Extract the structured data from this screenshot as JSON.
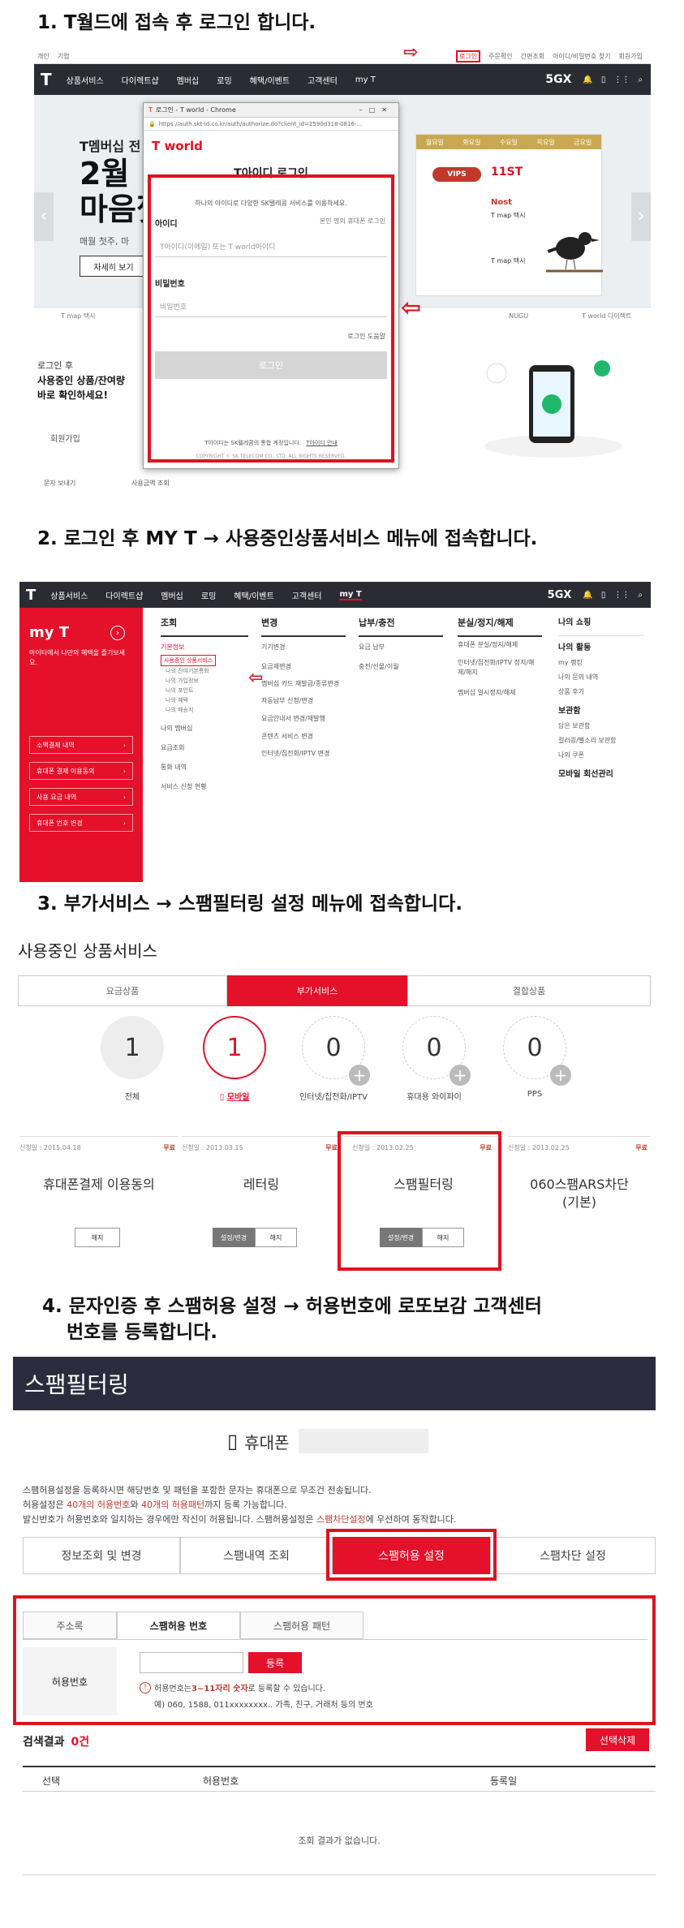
{
  "steps": {
    "s1": "1. T월드에 접속 후 로그인 합니다.",
    "s2": "2. 로그인 후 MY T → 사용중인상품서비스 메뉴에 접속합니다.",
    "s3": "3. 부가서비스 → 스팸필터링 설정 메뉴에 접속합니다.",
    "s4_line1": "4. 문자인증 후 스팸허용 설정  → 허용번호에 로또보감 고객센터",
    "s4_line2": "번호를 등록합니다."
  },
  "tworld": {
    "util_left": [
      "개인",
      "기업"
    ],
    "util_right": [
      "로그인",
      "주문확인",
      "간편조회",
      "아이디/비밀번호 찾기",
      "회원가입"
    ],
    "nav": [
      "상품서비스",
      "다이렉트샵",
      "멤버십",
      "로밍",
      "혜택/이벤트",
      "고객센터",
      "my T"
    ],
    "brand_5gx": "5GX",
    "hero_line1": "T멤버십 전",
    "hero_line2": "2월",
    "hero_line3": "마음껏",
    "hero_sub": "매월 첫주, 마",
    "hero_btn": "자세히 보기",
    "cal_days": [
      "월요일",
      "화요일",
      "수요일",
      "목요일",
      "금요일"
    ],
    "cal_items": [
      "VIPS",
      "11ST",
      "Nost",
      "T map 택시",
      "T map 택시"
    ],
    "tabs": [
      "T map 택시",
      "",
      "",
      "",
      "",
      "NUGU",
      "T world 다이렉트"
    ],
    "promo_line1": "로그인 후",
    "promo_line2": "사용중인 상품/잔여량",
    "promo_line3": "바로 확인하세요!",
    "bottom_items": [
      "회원가입",
      "문자 보내기",
      "사용금액 조회"
    ],
    "popup": {
      "window_title": "로그인 - T world - Chrome",
      "url": "https://auth.skt-id.co.kr/auth/authorize.do?client_id=2590d318-0816-...",
      "logo": "T world",
      "title": "T아이디 로그인",
      "desc": "하나의 아이디로 다양한 SK텔레콤 서비스를 이용하세요.",
      "id_label": "아이디",
      "id_hint": "본인 명의 휴대폰 로그인",
      "id_placeholder": "T아이디(이메일) 또는 T world아이디",
      "pw_label": "비밀번호",
      "pw_placeholder": "비밀번호",
      "help": "로그인 도움말",
      "login_btn": "로그인",
      "footer1": "T아이디는 SK텔레콤의 통합 계정입니다.",
      "footer_link": "T아이디 안내",
      "copyright": "COPYRIGHT © SK TELECOM CO., LTD. ALL RIGHTS RESERVED."
    }
  },
  "myt": {
    "nav": [
      "상품서비스",
      "다이렉트샵",
      "멤버십",
      "로밍",
      "혜택/이벤트",
      "고객센터",
      "my T"
    ],
    "brand_5gx": "5GX",
    "title": "my T",
    "desc": "마이티에서 나만의 혜택을 즐기보세요.",
    "side_buttons": [
      "소액결제 내역",
      "휴대폰 결제 이용동의",
      "사용 요금 내역",
      "휴대폰 번호 변경"
    ],
    "col1": {
      "head": "조회",
      "items": [
        "기본정보",
        "사용중인 상품서비스",
        "나의 잔여기본통화",
        "나의 가입정보",
        "나의 포인트",
        "나의 혜택",
        "나의 배송지",
        "나의 멤버십",
        "요금조회",
        "통화 내역",
        "서비스 신청 현황"
      ]
    },
    "col2": {
      "head": "변경",
      "items": [
        "기기변경",
        "요금제변경",
        "멤버십 카드 재발급/종류변경",
        "자동납부 신청/변경",
        "요금안내서 변경/재발행",
        "콘텐츠 서비스 변경",
        "인터넷/집전화/IPTV 변경"
      ]
    },
    "col3": {
      "head": "납부/충전",
      "items": [
        "요금 납부",
        "충전/선물/이월"
      ]
    },
    "col4": {
      "head": "분실/정지/해제",
      "items": [
        "휴대폰 분실/정지/해제",
        "인터넷/집전화/IPTV 정지/해제/해지",
        "멤버십 일시정지/해제"
      ]
    },
    "col5": {
      "items": [
        "나의 쇼핑",
        "나의 활동",
        "my 랭킹",
        "나의 문의 내역",
        "상품 후기",
        "보관함",
        "담은 보관함",
        "컬러링/벨소리 보관함",
        "나의 쿠폰",
        "모바일 회선관리"
      ]
    }
  },
  "services": {
    "title": "사용중인 상품서비스",
    "tabs": [
      "요금상품",
      "부가서비스",
      "결합상품"
    ],
    "counters": [
      {
        "value": "1",
        "label": "전체"
      },
      {
        "value": "1",
        "label": "모바일"
      },
      {
        "value": "0",
        "label": "인터넷/집전화/IPTV"
      },
      {
        "value": "0",
        "label": "휴대용 와이파이"
      },
      {
        "value": "0",
        "label": "PPS"
      }
    ],
    "cards": [
      {
        "date": "신청일 : 2015.04.18",
        "badge": "무료",
        "name": "휴대폰결제 이용동의",
        "btn1": "해지"
      },
      {
        "date": "신청일 : 2013.03.15",
        "badge": "무료",
        "name": "레터링",
        "btn1": "설정/변경",
        "btn2": "해지"
      },
      {
        "date": "신청일 : 2013.02.25",
        "badge": "무료",
        "name": "스팸필터링",
        "btn1": "설정/변경",
        "btn2": "해지"
      },
      {
        "date": "신청일 : 2013.02.25",
        "badge": "무료",
        "name": "060스팸ARS차단 (기본)"
      }
    ]
  },
  "spam": {
    "header": "스팸필터링",
    "device_label": "휴대폰",
    "info_line1": "스팸허용설정을 등록하시면 해당번호 및 패턴을 포함한 문자는 휴대폰으로 무조건 전송됩니다.",
    "info_line2a": "허용설정은 ",
    "info_line2b": "40개의 허용번호",
    "info_line2c": "와 ",
    "info_line2d": "40개의 허용패턴",
    "info_line2e": "까지 등록 가능합니다.",
    "info_line3a": "발신번호가 허용번호와 일치하는 경우에만 작신이 허용됩니다. 스팸허용설정은 ",
    "info_line3b": "스팸차단설정",
    "info_line3c": "에 우선하여 동작합니다.",
    "tabs": [
      "정보조회 및 변경",
      "스팸내역 조회",
      "스팸허용 설정",
      "스팸차단 설정"
    ],
    "subtabs": [
      "주소록",
      "스팸허용 번호",
      "스팸허용 패턴"
    ],
    "field_label": "허용번호",
    "register_btn": "등록",
    "hint1a": "허용번호는 ",
    "hint1b": "3~11자리 숫자",
    "hint1c": "로 등록할 수 있습니다.",
    "hint2": "예) 060, 1588, 011xxxxxxxx.. 가족, 친구, 거래처 등의 번호",
    "result_label": "검색결과",
    "result_count": "0건",
    "delete_btn": "선택삭제",
    "col_select": "선택",
    "col_number": "허용번호",
    "col_date": "등록일",
    "empty": "조회 결과가 없습니다."
  },
  "colors": {
    "accent": "#e5102a",
    "dark": "#2b2b33",
    "highlight": "#e0121f"
  }
}
